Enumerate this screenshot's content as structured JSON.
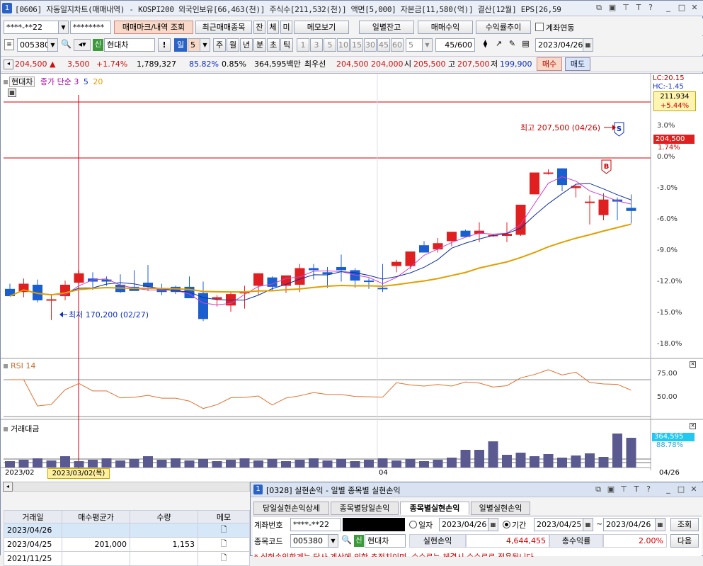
{
  "window": {
    "number": "1",
    "title": "[0606] 자동일지차트(매매내역) - KOSPI200 외국인보유[66,463(천)] 주식수[211,532(천)] 액면[5,000] 자본금[11,580(억)] 결산[12월] EPS[26,59"
  },
  "toolbar1": {
    "account": "****-**22",
    "password": "********",
    "trade_mark_btn": "매매마크/내역 조회",
    "recent_trades_btn": "최근매매종목",
    "view_btns": [
      "잔",
      "체",
      "미"
    ],
    "memo_btn": "메모보기",
    "daily_balance_btn": "일별잔고",
    "trade_profit_btn": "매매수익",
    "return_trend_btn": "수익률추이",
    "account_link_label": "계좌연동"
  },
  "toolbar2": {
    "code": "005380",
    "credit_tag": "신",
    "stock_name": "현대차",
    "exclaim": "!",
    "period_btn": "일",
    "period_value": "5",
    "period_tabs": [
      "주",
      "월",
      "년",
      "분",
      "초",
      "틱"
    ],
    "interval_tabs": [
      "1",
      "3",
      "5",
      "10",
      "15",
      "30",
      "45",
      "60"
    ],
    "count_select": "5",
    "count_display": "45",
    "count_total": "/600",
    "date": "2023/04/26"
  },
  "quote": {
    "price": "204,500",
    "change": "3,500",
    "change_pct": "+1.74%",
    "volume": "1,789,327",
    "ratio": "85.82%",
    "ratio2": "0.85%",
    "amount": "364,595백만",
    "pref_label": "최우선",
    "ask": "204,500",
    "bid": "204,000",
    "open_label": "시",
    "open": "205,500",
    "high_label": "고",
    "high": "207,500",
    "low_label": "저",
    "low": "199,900",
    "buy_btn": "매수",
    "sell_btn": "매도"
  },
  "chart": {
    "legend_stock": "현대차",
    "legend_close": "종가",
    "legend_simple": "단순",
    "legend_ma": [
      "3",
      "5",
      "20"
    ],
    "lc": "LC:20.15",
    "hc": "HC:-1.45",
    "price_box_value": "211,934",
    "price_box_pct": "+5.44%",
    "current_price_tag": "204,500",
    "current_pct_tag": "1.74%",
    "high_annotation": "최고 207,500 (04/26)",
    "low_annotation": "최저 170,200 (02/27)",
    "sell_mark": "S",
    "buy_mark": "B",
    "y_ticks": [
      "3.0%",
      "0.0%",
      "-3.0%",
      "-6.0%",
      "-9.0%",
      "-12.0%",
      "-15.0%",
      "-18.0%"
    ],
    "rsi_label": "RSI 14",
    "rsi_ticks": [
      "75.00",
      "50.00"
    ],
    "volume_label": "거래대금",
    "volume_tag": "364,595",
    "volume_pct_tag": "88.78%",
    "x_labels": [
      "2023/02",
      "2023/03/02(목)",
      "04",
      "04/26"
    ]
  },
  "chart_data": {
    "type": "candlestick",
    "x": [
      "02/21",
      "02/22",
      "02/23",
      "02/24",
      "02/27",
      "02/28",
      "03/02",
      "03/03",
      "03/06",
      "03/07",
      "03/08",
      "03/09",
      "03/10",
      "03/13",
      "03/14",
      "03/15",
      "03/16",
      "03/17",
      "03/20",
      "03/21",
      "03/22",
      "03/23",
      "03/24",
      "03/27",
      "03/28",
      "03/29",
      "03/30",
      "03/31",
      "04/03",
      "04/04",
      "04/05",
      "04/06",
      "04/07",
      "04/10",
      "04/11",
      "04/12",
      "04/13",
      "04/14",
      "04/17",
      "04/18",
      "04/19",
      "04/20",
      "04/21",
      "04/24",
      "04/25",
      "04/26"
    ],
    "ohlc_pct": [
      [
        -12.6,
        -12.1,
        -13.3,
        -13.3
      ],
      [
        -12.9,
        -11.6,
        -13.4,
        -12.1
      ],
      [
        -12.2,
        -11.7,
        -13.9,
        -13.7
      ],
      [
        -13.6,
        -13.2,
        -15.6,
        -13.6
      ],
      [
        -13.3,
        -11.8,
        -13.7,
        -12.2
      ],
      [
        -12.0,
        -10.8,
        -12.1,
        -11.1
      ],
      [
        -11.6,
        -11.0,
        -12.7,
        -11.9
      ],
      [
        -11.7,
        -11.4,
        -12.3,
        -11.9
      ],
      [
        -12.2,
        -11.2,
        -13.0,
        -12.9
      ],
      [
        -12.4,
        -10.8,
        -12.5,
        -12.8
      ],
      [
        -12.0,
        -10.3,
        -12.8,
        -12.4
      ],
      [
        -12.6,
        -12.1,
        -13.2,
        -12.9
      ],
      [
        -12.4,
        -12.3,
        -13.1,
        -12.9
      ],
      [
        -12.4,
        -11.4,
        -13.0,
        -13.5
      ],
      [
        -13.0,
        -11.9,
        -15.7,
        -15.5
      ],
      [
        -13.6,
        -13.2,
        -14.3,
        -13.4
      ],
      [
        -14.2,
        -12.9,
        -14.8,
        -13.1
      ],
      [
        -12.9,
        -12.3,
        -14.5,
        -12.9
      ],
      [
        -12.3,
        -11.9,
        -13.2,
        -11.1
      ],
      [
        -11.5,
        -11.4,
        -12.8,
        -12.4
      ],
      [
        -12.3,
        -11.9,
        -13.0,
        -11.3
      ],
      [
        -12.2,
        -10.2,
        -12.9,
        -10.6
      ],
      [
        -10.6,
        -10.2,
        -11.7,
        -10.8
      ],
      [
        -11.0,
        -10.5,
        -12.5,
        -11.2
      ],
      [
        -10.5,
        -9.3,
        -11.9,
        -10.8
      ],
      [
        -10.8,
        -10.6,
        -12.5,
        -11.8
      ],
      [
        -11.8,
        -11.6,
        -12.6,
        -11.9
      ],
      [
        -12.5,
        -10.2,
        -12.9,
        -12.6
      ],
      [
        -10.4,
        -9.8,
        -11.0,
        -10.0
      ],
      [
        -10.4,
        -9.2,
        -10.7,
        -9.0
      ],
      [
        -8.4,
        -8.0,
        -9.0,
        -9.1
      ],
      [
        -8.8,
        -7.7,
        -9.1,
        -8.2
      ],
      [
        -8.0,
        -7.4,
        -8.5,
        -7.1
      ],
      [
        -7.0,
        -6.9,
        -7.6,
        -7.6
      ],
      [
        -7.3,
        -6.2,
        -8.1,
        -7.0
      ],
      [
        -7.5,
        -7.3,
        -7.6,
        -7.4
      ],
      [
        -7.5,
        -6.2,
        -8.1,
        -7.3
      ],
      [
        -7.4,
        -4.5,
        -7.5,
        -4.5
      ],
      [
        -3.5,
        -1.4,
        -3.5,
        -1.4
      ],
      [
        -1.4,
        -1.1,
        -1.6,
        -1.4
      ],
      [
        -1.0,
        -1.0,
        -3.2,
        -2.6
      ],
      [
        -2.9,
        -2.6,
        -3.8,
        -2.7
      ],
      [
        -4.2,
        -3.6,
        -6.4,
        -4.2
      ],
      [
        -5.5,
        -3.4,
        -6.0,
        -4.0
      ],
      [
        -4.0,
        -3.8,
        -6.0,
        -4.2
      ],
      [
        -4.8,
        -3.5,
        -6.3,
        -5.1
      ]
    ],
    "ylim": [
      -19.5,
      5.0
    ],
    "y_unit": "%"
  },
  "bottom_left": {
    "columns": [
      "거래일",
      "매수평균가",
      "수량",
      "메모"
    ],
    "rows": [
      {
        "date": "2023/04/26",
        "avg": "",
        "qty": ""
      },
      {
        "date": "2023/04/25",
        "avg": "201,000",
        "qty": "1,153"
      },
      {
        "date": "2021/11/25",
        "avg": "",
        "qty": ""
      }
    ]
  },
  "subwindow": {
    "number": "1",
    "title": "[0328] 실현손익 - 일별 종목별 실현손익",
    "tabs": [
      "당일실현손익상세",
      "종목별당일손익",
      "종목별실현손익",
      "일별실현손익"
    ],
    "active_tab": 2,
    "account_label": "계좌번호",
    "account": "****-**22",
    "radio_day": "일자",
    "day_date": "2023/04/26",
    "radio_period": "기간",
    "from_date": "2023/04/25",
    "to_date": "2023/04/26",
    "query_btn": "조회",
    "code_label": "종목코드",
    "code": "005380",
    "credit_tag": "신",
    "stock_name": "현대차",
    "realized_label": "실현손익",
    "realized_value": "4,644,455",
    "total_return_label": "총수익률",
    "total_return_value": "2.00%",
    "next_btn": "다음",
    "notice": "* 실현손익합계는 당사 계산에 의한 추정치이며, 수수료는 체결시 수수료로 적용됩니다."
  }
}
